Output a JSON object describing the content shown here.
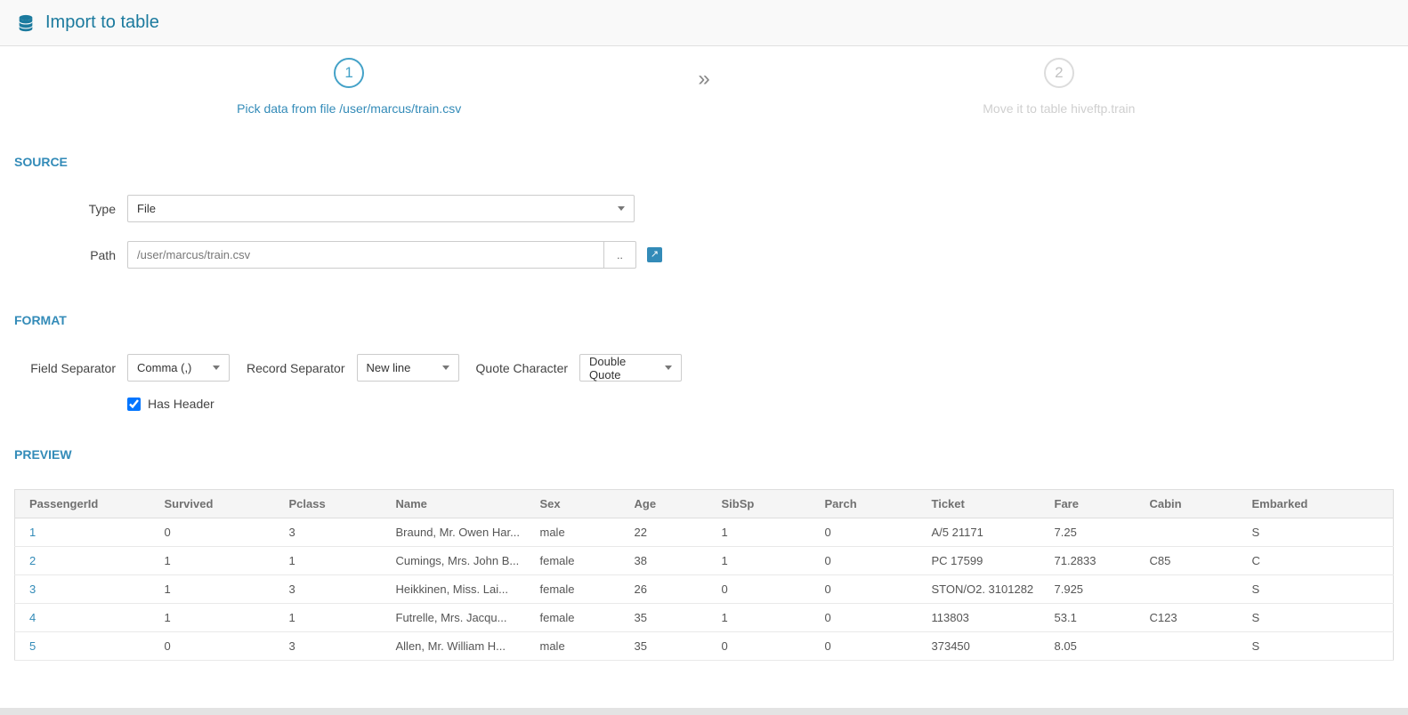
{
  "header": {
    "title": "Import to table"
  },
  "icons": {
    "double_chevron": "»",
    "external_link": "↗"
  },
  "wizard": {
    "steps": [
      {
        "number": "1",
        "label": "Pick data from file /user/marcus/train.csv"
      },
      {
        "number": "2",
        "label": "Move it to table hiveftp.train"
      }
    ]
  },
  "source": {
    "heading": "SOURCE",
    "type_label": "Type",
    "type_value": "File",
    "path_label": "Path",
    "path_value": "/user/marcus/train.csv",
    "browse_label": ".."
  },
  "format": {
    "heading": "FORMAT",
    "field_separator_label": "Field Separator",
    "field_separator_value": "Comma (,)",
    "record_separator_label": "Record Separator",
    "record_separator_value": "New line",
    "quote_character_label": "Quote Character",
    "quote_character_value": "Double Quote",
    "has_header_label": "Has Header",
    "has_header_checked": true
  },
  "preview": {
    "heading": "PREVIEW",
    "columns": [
      "PassengerId",
      "Survived",
      "Pclass",
      "Name",
      "Sex",
      "Age",
      "SibSp",
      "Parch",
      "Ticket",
      "Fare",
      "Cabin",
      "Embarked"
    ],
    "rows": [
      [
        "1",
        "0",
        "3",
        "Braund, Mr. Owen Har...",
        "male",
        "22",
        "1",
        "0",
        "A/5 21171",
        "7.25",
        "",
        "S"
      ],
      [
        "2",
        "1",
        "1",
        "Cumings, Mrs. John B...",
        "female",
        "38",
        "1",
        "0",
        "PC 17599",
        "71.2833",
        "C85",
        "C"
      ],
      [
        "3",
        "1",
        "3",
        "Heikkinen, Miss. Lai...",
        "female",
        "26",
        "0",
        "0",
        "STON/O2. 3101282",
        "7.925",
        "",
        "S"
      ],
      [
        "4",
        "1",
        "1",
        "Futrelle, Mrs. Jacqu...",
        "female",
        "35",
        "1",
        "0",
        "113803",
        "53.1",
        "C123",
        "S"
      ],
      [
        "5",
        "0",
        "3",
        "Allen, Mr. William H...",
        "male",
        "35",
        "0",
        "0",
        "373450",
        "8.05",
        "",
        "S"
      ]
    ]
  },
  "colors": {
    "accent": "#338bb8",
    "title": "#1b7a9e"
  }
}
